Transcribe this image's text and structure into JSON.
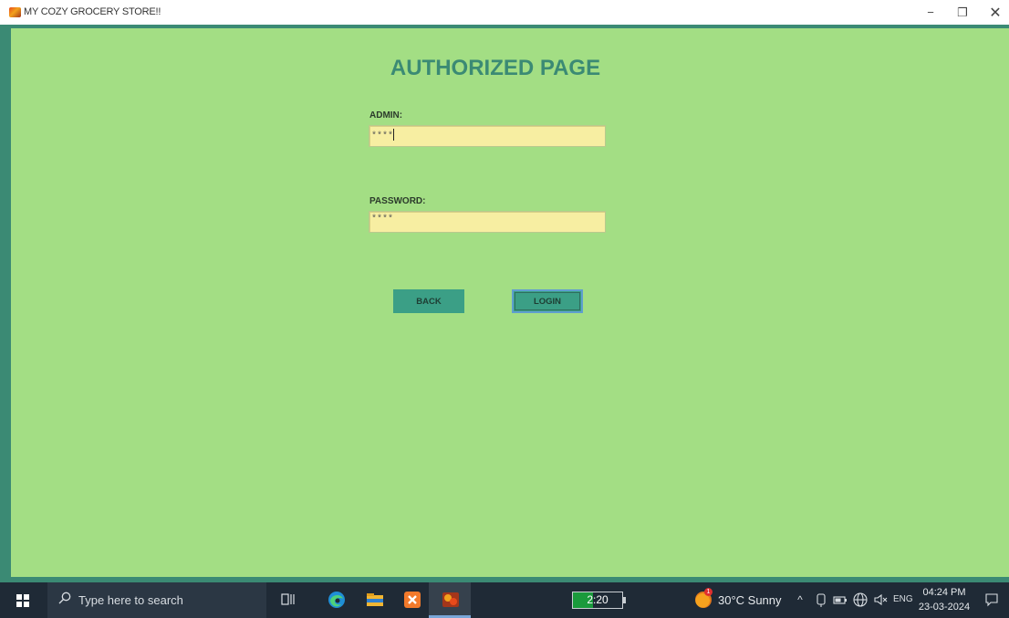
{
  "window": {
    "title": "MY COZY GROCERY STORE!!",
    "controls": {
      "minimize": "−",
      "maximize": "❐",
      "close": "✕"
    }
  },
  "form": {
    "heading": "AUTHORIZED PAGE",
    "admin_label": "ADMIN:",
    "admin_value": "****",
    "password_label": "PASSWORD:",
    "password_value": "****",
    "back_label": "BACK",
    "login_label": "LOGIN"
  },
  "colors": {
    "background": "#a3de84",
    "frame": "#3b8a74",
    "heading": "#3b8a74",
    "input_bg": "#f7eea2",
    "button_bg": "#3b9f86"
  },
  "taskbar": {
    "search_placeholder": "Type here to search",
    "pinned_icons": [
      "task-view-icon",
      "edge-icon",
      "file-explorer-icon",
      "xampp-icon",
      "grocery-app-icon"
    ],
    "battery_timer": "2:20",
    "battery_level": 0.4,
    "weather": "30°C  Sunny",
    "weather_badge": "1",
    "language": "ENG",
    "time": "04:24 PM",
    "date": "23-03-2024"
  }
}
